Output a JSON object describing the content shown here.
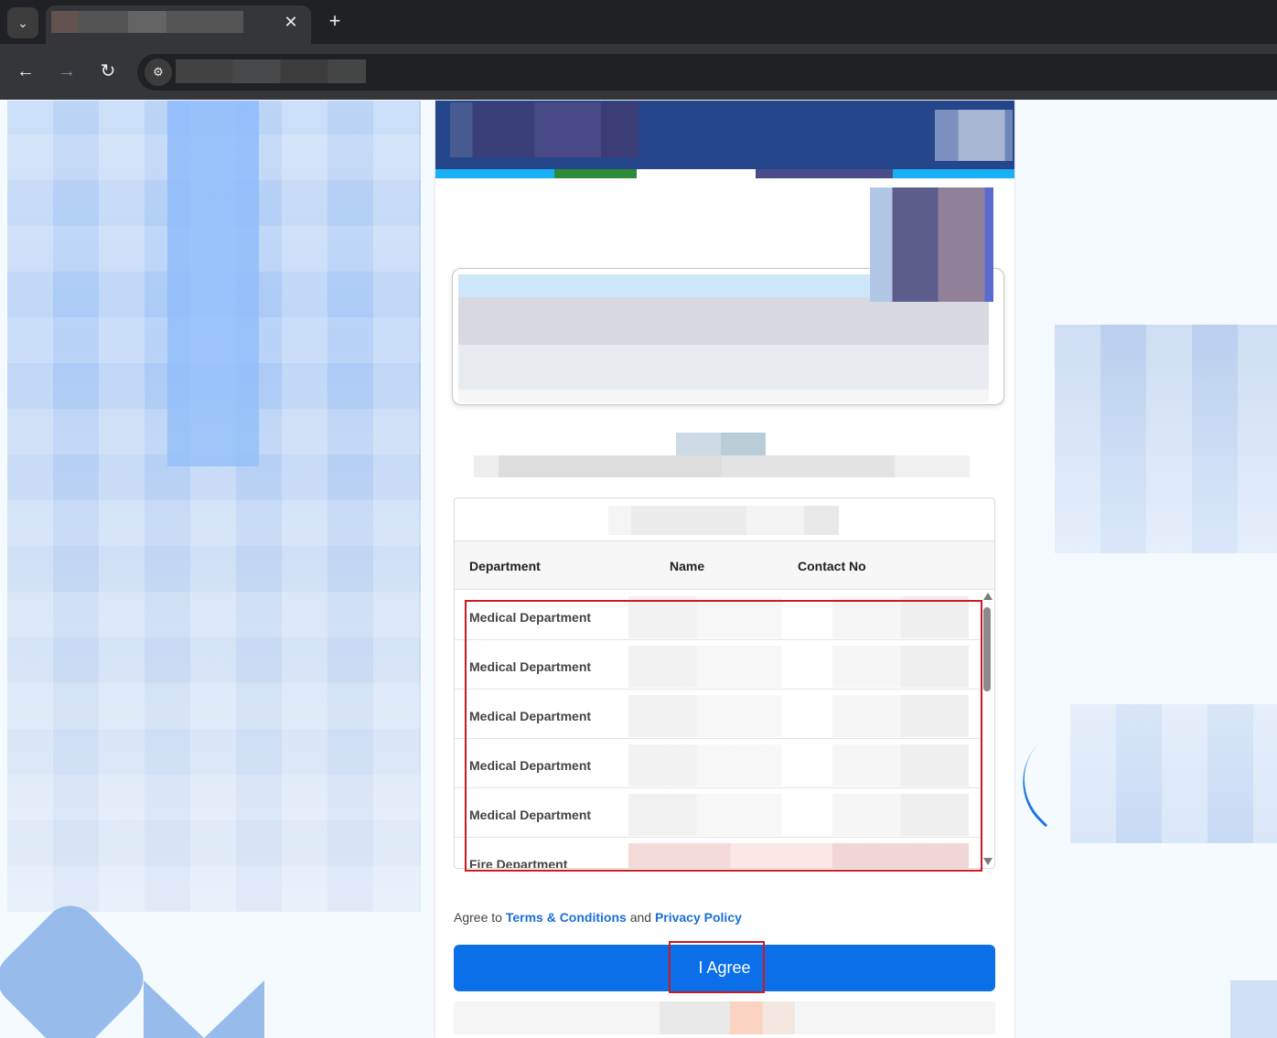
{
  "browser": {
    "tab_menu_icon": "chevron-down-icon",
    "tab_close_glyph": "✕",
    "new_tab_glyph": "+",
    "back_glyph": "←",
    "forward_glyph": "→",
    "reload_glyph": "↻",
    "site_info_glyph": "⚙"
  },
  "contacts": {
    "headers": {
      "department": "Department",
      "name": "Name",
      "contact_no": "Contact No"
    },
    "rows": [
      {
        "department": "Medical Department"
      },
      {
        "department": "Medical Department"
      },
      {
        "department": "Medical Department"
      },
      {
        "department": "Medical Department"
      },
      {
        "department": "Medical Department"
      },
      {
        "department": "Fire Department"
      }
    ]
  },
  "agreement": {
    "prefix": "Agree to",
    "terms_link": "Terms & Conditions",
    "conjunction": "and",
    "privacy_link": "Privacy Policy",
    "button_label": "I Agree"
  },
  "colors": {
    "primary": "#0a6fe8",
    "header": "#25468a",
    "highlight": "#d0191e"
  }
}
